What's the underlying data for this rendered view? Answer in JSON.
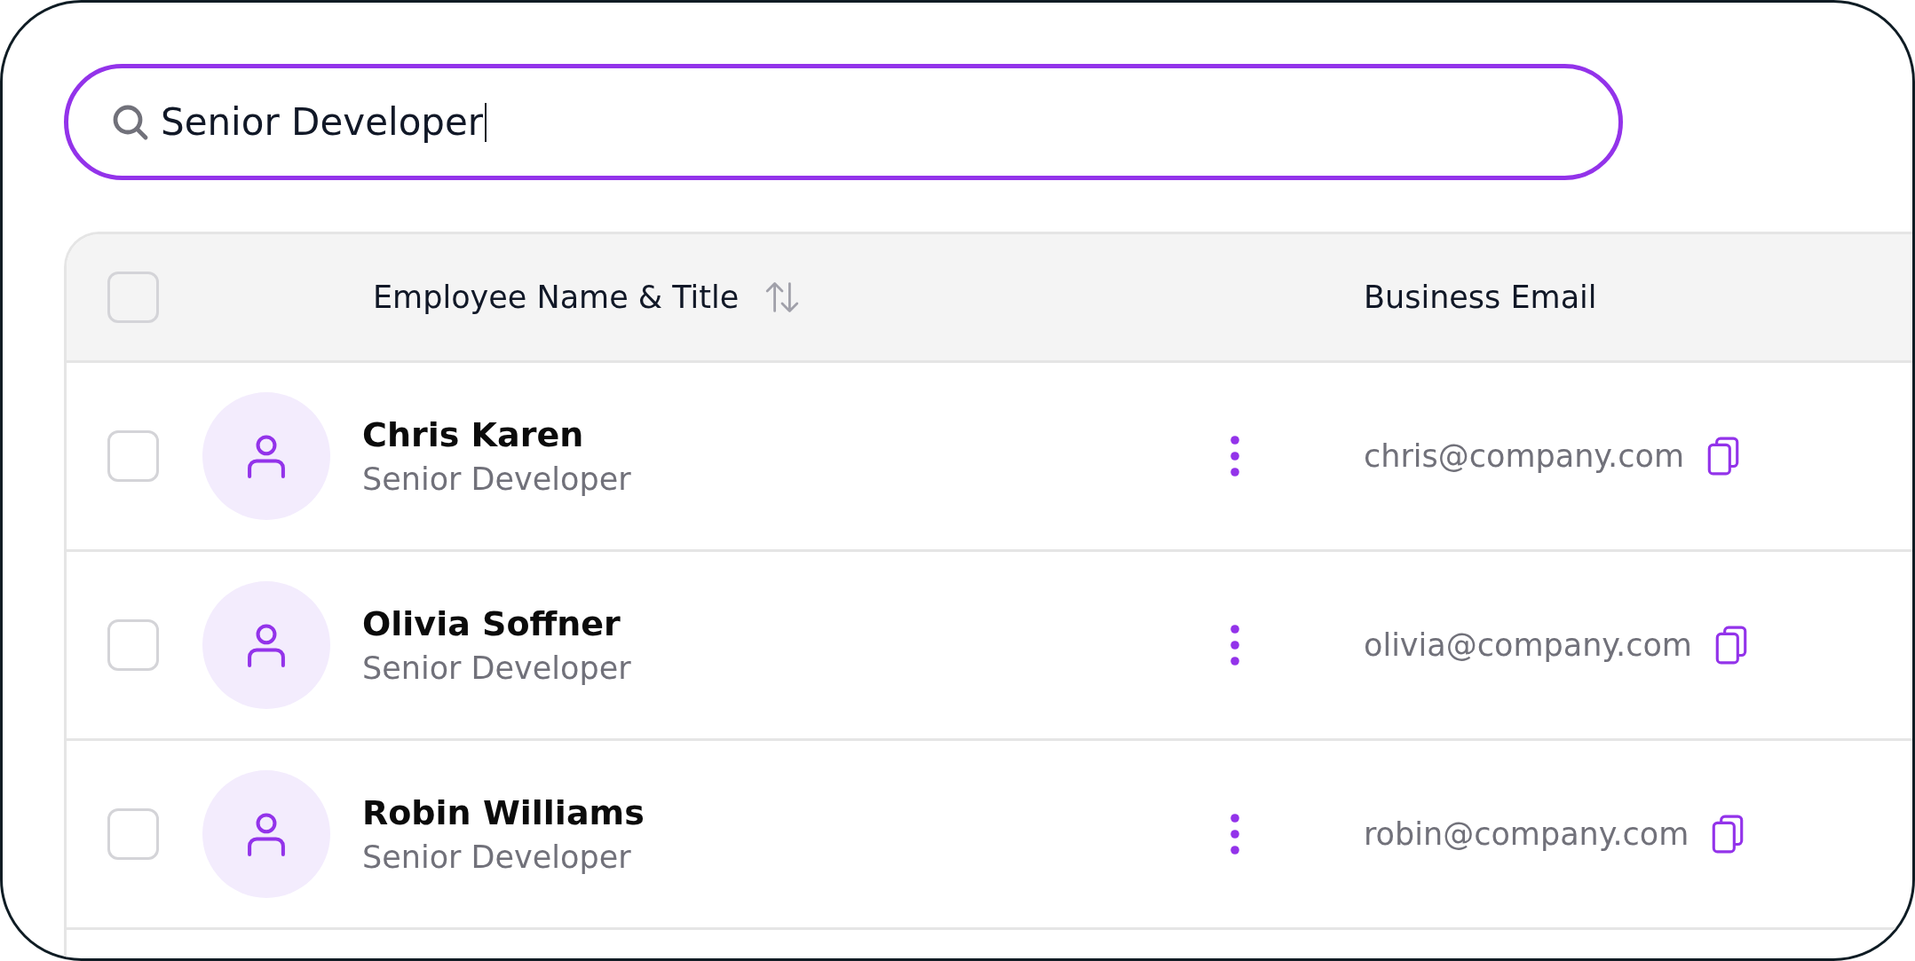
{
  "search": {
    "value": "Senior Developer",
    "focused": true
  },
  "table": {
    "select_all": {
      "checked": false
    },
    "columns": [
      {
        "label": "Employee Name & Title",
        "sortable": true
      },
      {
        "label": "Business Email",
        "sortable": false
      }
    ],
    "rows": [
      {
        "checked": false,
        "name": "Chris Karen",
        "title": "Senior Developer",
        "email": "chris@company.com"
      },
      {
        "checked": false,
        "name": "Olivia Soffner",
        "title": "Senior Developer",
        "email": "olivia@company.com"
      },
      {
        "checked": false,
        "name": "Robin Williams",
        "title": "Senior Developer",
        "email": "robin@company.com"
      }
    ]
  }
}
